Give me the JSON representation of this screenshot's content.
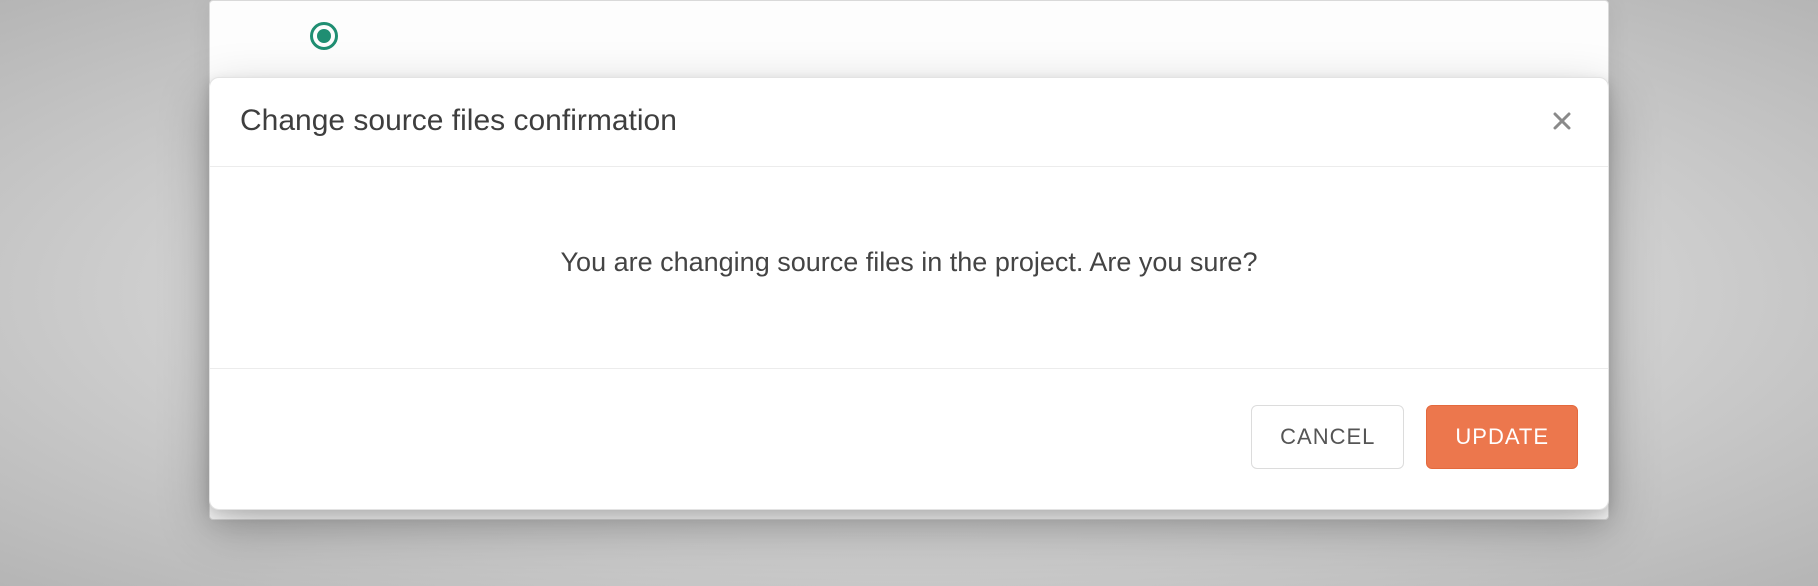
{
  "dialog": {
    "title": "Change source files confirmation",
    "message": "You are changing source files in the project. Are you sure?",
    "cancel_label": "CANCEL",
    "confirm_label": "UPDATE",
    "close_icon": "close-icon"
  },
  "colors": {
    "primary_button_bg": "#ec774d",
    "primary_button_text": "#ffffff",
    "secondary_button_border": "#dcdcdc",
    "text_color": "#3e3e3e"
  }
}
